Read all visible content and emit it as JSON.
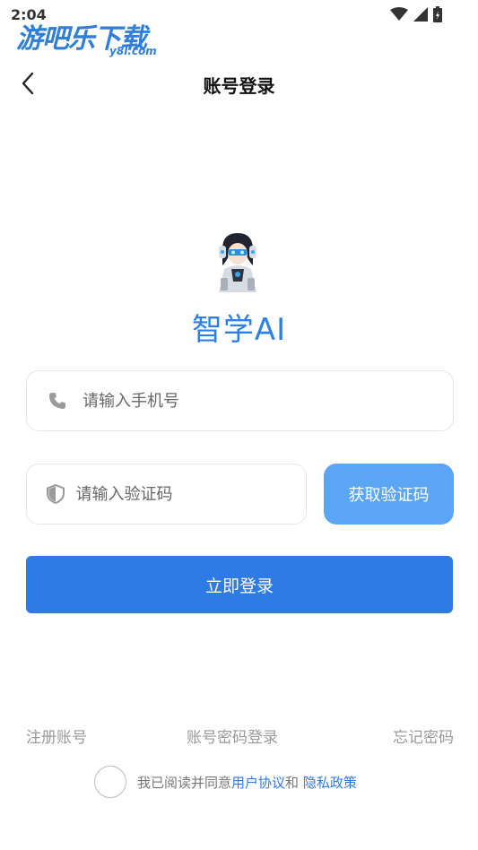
{
  "status_bar": {
    "time": "2:04"
  },
  "watermark": {
    "main": "游吧乐下载",
    "sub": "y8l.com"
  },
  "nav": {
    "title": "账号登录"
  },
  "app": {
    "name": "智学AI"
  },
  "form": {
    "phone_placeholder": "请输入手机号",
    "code_placeholder": "请输入验证码",
    "get_code_label": "获取验证码",
    "login_label": "立即登录"
  },
  "links": {
    "register": "注册账号",
    "password_login": "账号密码登录",
    "forgot_password": "忘记密码"
  },
  "agreement": {
    "prefix": "我已阅读并同意",
    "user_agreement": "用户协议",
    "and": "和 ",
    "privacy_policy": "隐私政策"
  },
  "colors": {
    "accent": "#2e7be6",
    "accent_light": "#5aa6f5",
    "muted_text": "#999999"
  }
}
